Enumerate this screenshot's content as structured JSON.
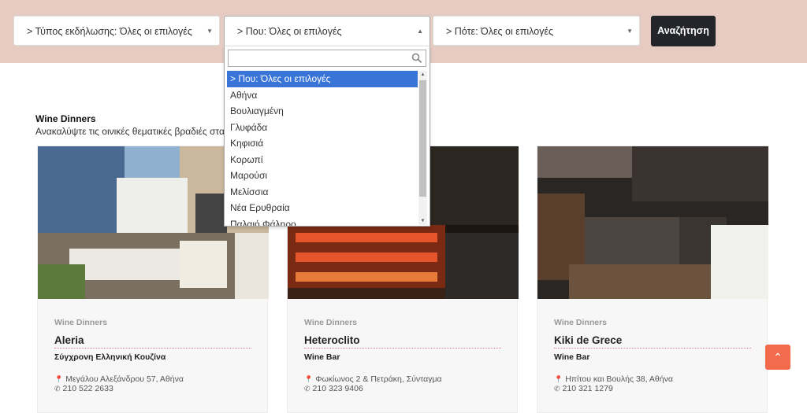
{
  "filters": {
    "type_label": "> Τύπος εκδήλωσης: Όλες οι επιλογές",
    "where_label": "> Που: Όλες οι επιλογές",
    "when_label": "> Πότε: Όλες οι επιλογές",
    "search_button": "Αναζήτηση"
  },
  "dropdown": {
    "search_value": "",
    "options": [
      "> Που: Όλες οι επιλογές",
      "Αθήνα",
      "Βουλιαγμένη",
      "Γλυφάδα",
      "Κηφισιά",
      "Κορωπί",
      "Μαρούσι",
      "Μελίσσια",
      "Νέα Ερυθραία",
      "Παλαιό Φάληρο"
    ],
    "selected_index": 0
  },
  "intro": {
    "heading": "Wine Dinners",
    "description": "Ανακαλύψτε τις οινικές θεματικές βραδιές  στα ε"
  },
  "cards": [
    {
      "category": "Wine Dinners",
      "name": "Aleria",
      "kind": "Σύγχρονη Ελληνική Κουζίνα",
      "address": "Μεγάλου Αλεξάνδρου 57, Αθήνα",
      "phone": "210 522 2633"
    },
    {
      "category": "Wine Dinners",
      "name": "Heteroclito",
      "kind": "Wine Bar",
      "address": "Φωκίωνος 2 & Πετράκη, Σύνταγμα",
      "phone": "210 323 9406"
    },
    {
      "category": "Wine Dinners",
      "name": "Kiki de Grece",
      "kind": "Wine Bar",
      "address": "Ηπίτου και Βουλής 38, Αθήνα",
      "phone": "210 321 1279"
    }
  ],
  "icons": {
    "address": "map-marker-icon",
    "phone": "phone-icon",
    "back_to_top": "chevron-up-icon",
    "search": "search-icon"
  },
  "colors": {
    "search_bar_bg": "#e6cbc2",
    "button_dark": "#23252b",
    "highlight": "#3875d7",
    "back_to_top": "#f26b4d",
    "title_underline": "#e87a9a"
  }
}
